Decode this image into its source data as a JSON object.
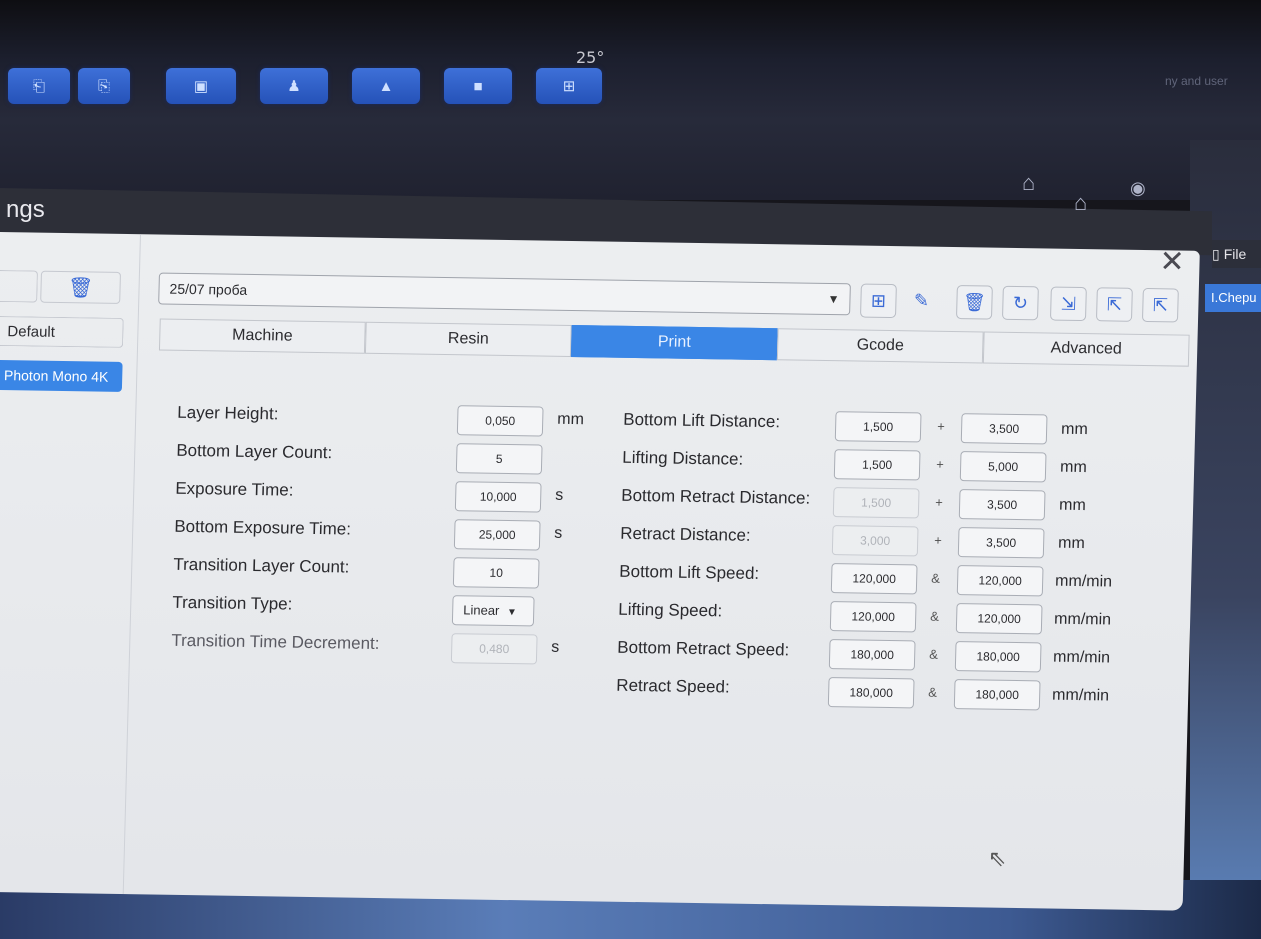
{
  "taskbar": {
    "temperature": "25°",
    "right_text": "ny and user"
  },
  "window": {
    "title": "ngs",
    "close_glyph": "✕"
  },
  "side": {
    "file_label": "File",
    "user_label": "I.Chepu"
  },
  "left_panel": {
    "default_label": "Default",
    "printer_label": ": Photon Mono 4K"
  },
  "profile": {
    "selected": "25/07 проба"
  },
  "tabs": [
    "Machine",
    "Resin",
    "Print",
    "Gcode",
    "Advanced"
  ],
  "active_tab": "Print",
  "left_fields": [
    {
      "label": "Layer Height:",
      "value": "0,050",
      "unit": "mm"
    },
    {
      "label": "Bottom Layer Count:",
      "value": "5",
      "unit": ""
    },
    {
      "label": "Exposure Time:",
      "value": "10,000",
      "unit": "s"
    },
    {
      "label": "Bottom Exposure Time:",
      "value": "25,000",
      "unit": "s"
    },
    {
      "label": "Transition Layer Count:",
      "value": "10",
      "unit": ""
    },
    {
      "label": "Transition Type:",
      "value": "Linear",
      "unit": ""
    },
    {
      "label": "Transition Time Decrement:",
      "value": "0,480",
      "unit": "s"
    }
  ],
  "right_fields": [
    {
      "label": "Bottom Lift Distance:",
      "v1": "1,500",
      "sep": "+",
      "v2": "3,500",
      "unit": "mm"
    },
    {
      "label": "Lifting Distance:",
      "v1": "1,500",
      "sep": "+",
      "v2": "5,000",
      "unit": "mm"
    },
    {
      "label": "Bottom Retract Distance:",
      "v1": "1,500",
      "sep": "+",
      "v2": "3,500",
      "unit": "mm"
    },
    {
      "label": "Retract Distance:",
      "v1": "3,000",
      "sep": "+",
      "v2": "3,500",
      "unit": "mm"
    },
    {
      "label": "Bottom Lift Speed:",
      "v1": "120,000",
      "sep": "&",
      "v2": "120,000",
      "unit": "mm/min"
    },
    {
      "label": "Lifting Speed:",
      "v1": "120,000",
      "sep": "&",
      "v2": "120,000",
      "unit": "mm/min"
    },
    {
      "label": "Bottom Retract Speed:",
      "v1": "180,000",
      "sep": "&",
      "v2": "180,000",
      "unit": "mm/min"
    },
    {
      "label": "Retract Speed:",
      "v1": "180,000",
      "sep": "&",
      "v2": "180,000",
      "unit": "mm/min"
    }
  ]
}
